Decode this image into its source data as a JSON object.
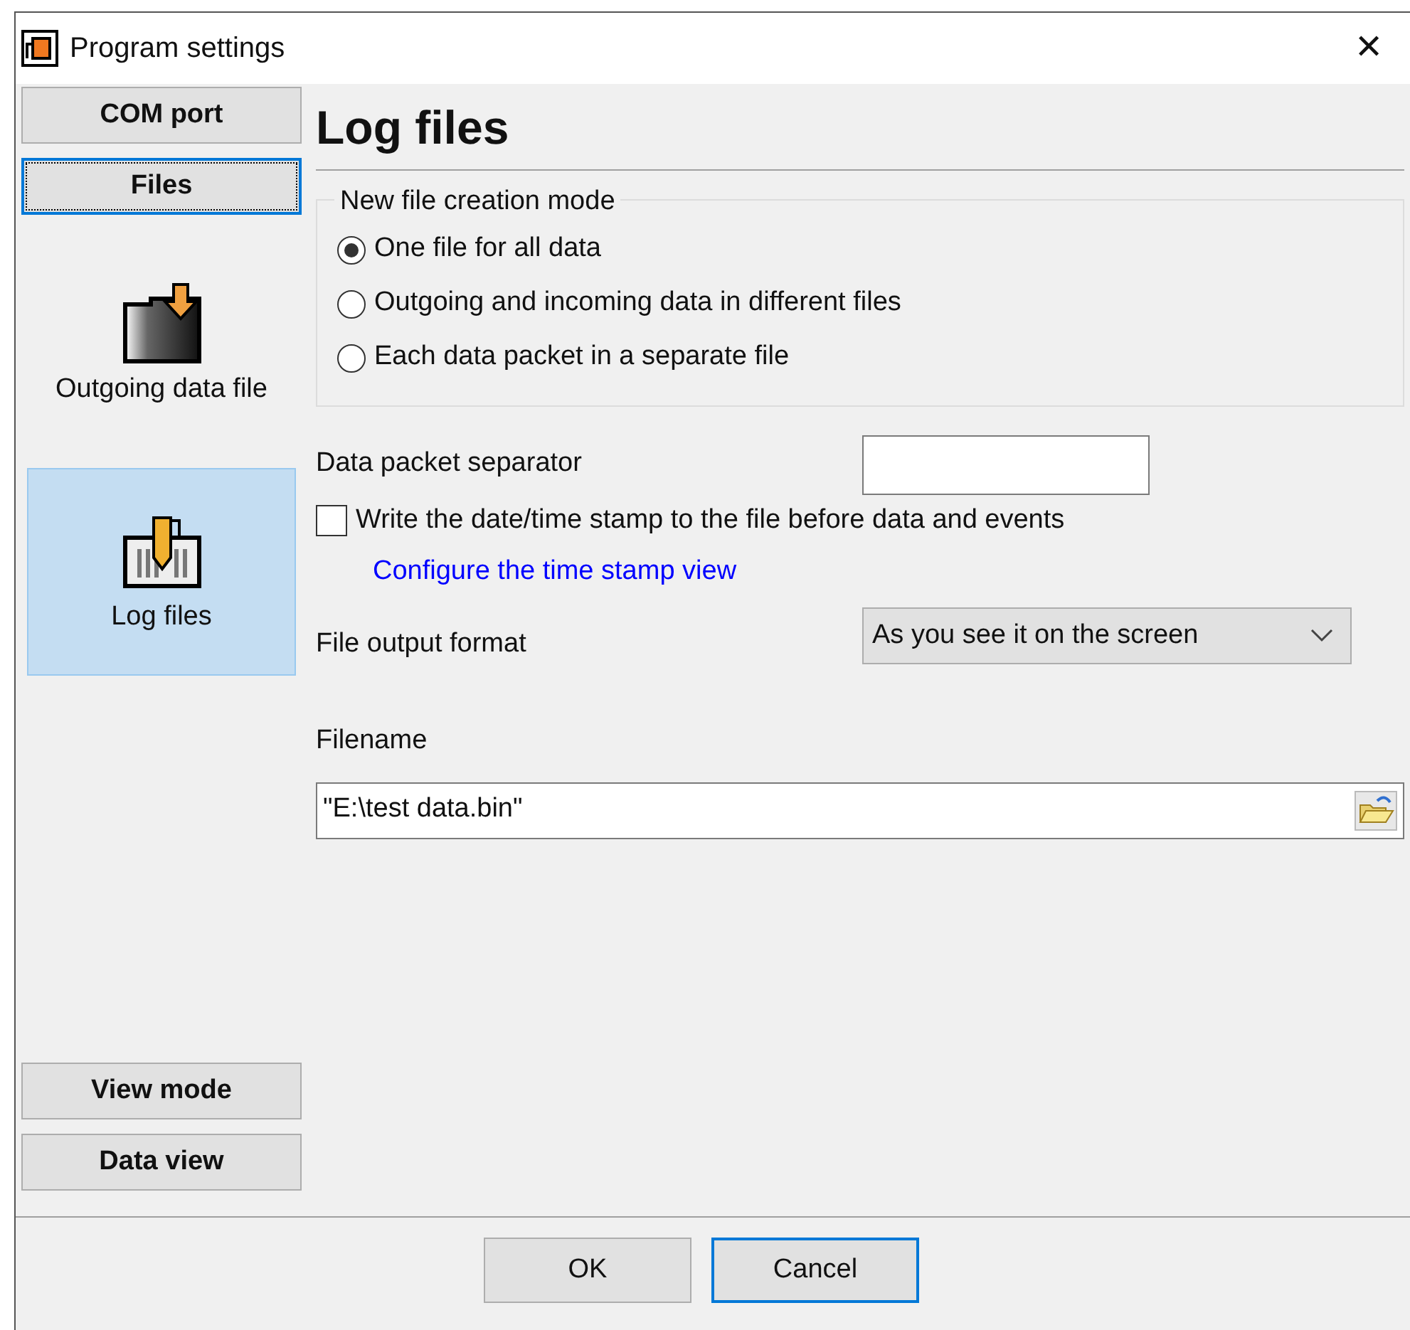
{
  "window": {
    "title": "Program settings",
    "close": "✕"
  },
  "sidebar": {
    "top_buttons": [
      {
        "label": "COM port",
        "selected": false
      },
      {
        "label": "Files",
        "selected": true
      }
    ],
    "items": [
      {
        "label": "Outgoing data file",
        "kind": "outgoing",
        "selected": false
      },
      {
        "label": "Log files",
        "kind": "log",
        "selected": true
      }
    ],
    "bottom_buttons": [
      {
        "label": "View mode",
        "selected": false
      },
      {
        "label": "Data view",
        "selected": false
      }
    ]
  },
  "page": {
    "heading": "Log files",
    "creation_mode": {
      "legend": "New file creation mode",
      "options": [
        {
          "label": "One file for all data",
          "selected": true
        },
        {
          "label": "Outgoing and incoming data in different files",
          "selected": false
        },
        {
          "label": "Each data packet in a separate file",
          "selected": false
        }
      ]
    },
    "separator": {
      "label": "Data packet separator"
    },
    "timestamp": {
      "label": "Write the date/time stamp to the file before data and events",
      "checked": false
    },
    "timestamp_link": "Configure the time stamp view",
    "output_format": {
      "label": "File output format",
      "value": "As you see it on the screen"
    },
    "filename": {
      "label": "Filename",
      "value": "\"E:\\test data.bin\""
    }
  },
  "buttons": [
    {
      "label": "OK",
      "focused": false
    },
    {
      "label": "Cancel",
      "focused": true
    }
  ]
}
